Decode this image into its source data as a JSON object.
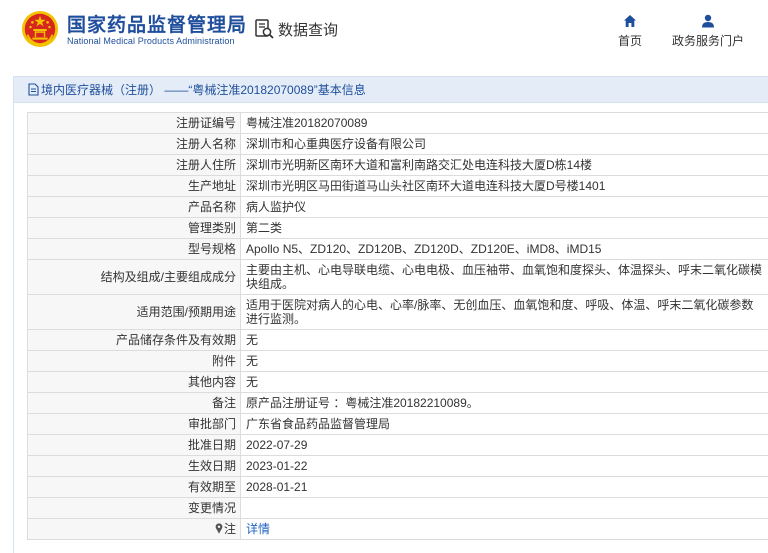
{
  "header": {
    "org_name_cn": "国家药品监督管理局",
    "org_name_en": "National Medical Products Administration",
    "data_query_label": "数据查询",
    "nav": [
      {
        "label": "首页",
        "icon": "home-icon"
      },
      {
        "label": "政务服务门户",
        "icon": "user-icon"
      }
    ]
  },
  "breadcrumb": {
    "text": "境内医疗器械（注册） ——“粤械注准20182070089”基本信息",
    "icon": "document-icon"
  },
  "record": {
    "rows": [
      {
        "label": "注册证编号",
        "value": "粤械注准20182070089"
      },
      {
        "label": "注册人名称",
        "value": "深圳市和心重典医疗设备有限公司"
      },
      {
        "label": "注册人住所",
        "value": "深圳市光明新区南环大道和富利南路交汇处电连科技大厦D栋14楼"
      },
      {
        "label": "生产地址",
        "value": "深圳市光明区马田街道马山头社区南环大道电连科技大厦D号楼1401"
      },
      {
        "label": "产品名称",
        "value": "病人监护仪"
      },
      {
        "label": "管理类别",
        "value": "第二类"
      },
      {
        "label": "型号规格",
        "value": "Apollo N5、ZD120、ZD120B、ZD120D、ZD120E、iMD8、iMD15"
      },
      {
        "label": "结构及组成/主要组成成分",
        "value": "主要由主机、心电导联电缆、心电电极、血压袖带、血氧饱和度探头、体温探头、呼末二氧化碳模块组成。"
      },
      {
        "label": "适用范围/预期用途",
        "value": "适用于医院对病人的心电、心率/脉率、无创血压、血氧饱和度、呼吸、体温、呼末二氧化碳参数进行监测。"
      },
      {
        "label": "产品储存条件及有效期",
        "value": "无"
      },
      {
        "label": "附件",
        "value": "无"
      },
      {
        "label": "其他内容",
        "value": "无"
      },
      {
        "label": "备注",
        "value": "原产品注册证号 ：粤械注准20182210089。"
      },
      {
        "label": "审批部门",
        "value": "广东省食品药品监督管理局"
      },
      {
        "label": "批准日期",
        "value": "2022-07-29"
      },
      {
        "label": "生效日期",
        "value": "2023-01-22"
      },
      {
        "label": "有效期至",
        "value": "2028-01-21"
      },
      {
        "label": "变更情况",
        "value": ""
      }
    ],
    "note_label": "注",
    "note_link": "详情"
  },
  "colors": {
    "brand_blue": "#1f4e9c",
    "header_bar": "#e4edf7",
    "link": "#1f63c6",
    "emblem_red": "#d7261e",
    "emblem_gold": "#f2c200"
  }
}
